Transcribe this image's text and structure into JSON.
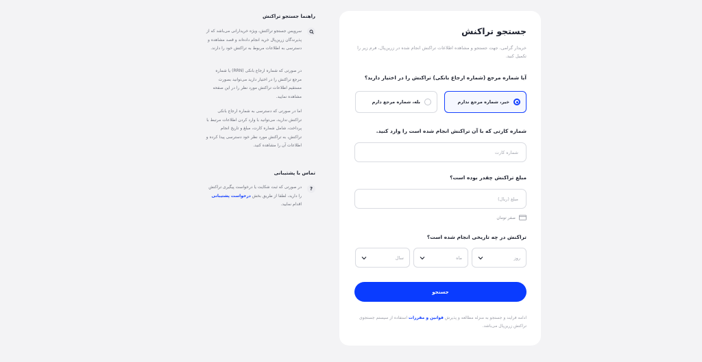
{
  "card": {
    "title": "جستجو تراکنش",
    "description": "خریدار گرامی، جهت جستجو و مشاهده اطلاعات تراکنش انجام شده در زرین‌پال، فرم زیر را تکمیل کنید.",
    "question_ref": "آیا شماره مرجع (شماره ارجاع بانکی) تراکنش را در اختیار دارید؟",
    "option_no": "خیر، شماره مرجع ندارم",
    "option_yes": "بله، شماره مرجع دارم",
    "selected_option": "no",
    "question_card": "شماره کارتی که با آن تراکنش انجام شده است را وارد کنید.",
    "card_placeholder": "شماره کارت",
    "question_amount": "مبلغ تراکنش چقدر بوده است؟",
    "amount_placeholder": "مبلغ (ریال)",
    "amount_in_words": "صفر تومان",
    "question_date": "تراکنش در چه تاریخی انجام شده است؟",
    "day_placeholder": "روز",
    "month_placeholder": "ماه",
    "year_placeholder": "سال",
    "search_label": "جستجو",
    "terms_before": "ادامه فرایند و جستجو به منزله مطالعه و پذیرش ",
    "terms_link": "قوانین و مقررات",
    "terms_after": " استفاده از سیستم جستجوی تراکنش زرین‌پال می‌باشد.",
    "accent_color": "#0a3cff"
  },
  "guide": {
    "title": "راهنما جستجو تراکنش",
    "p1": "سرویس جستجو تراکنش، ویژه خریدارانی می‌باشد که از پذیرندگان زرین‌پال خرید انجام داده‌اند و قصد مشاهده و دسترسی به اطلاعات مربوط به تراکنش خود را دارند.",
    "p2": "در صورتی که شماره ارجاع بانکی (RRN) یا شماره مرجع تراکنش را در اختیار دارید می‌توانید بصورت مستقیم اطلاعات تراکنش مورد نظر را در این صفحه مشاهده نمایید.",
    "p3": "اما در صورتی که دسترسی به شماره ارجاع بانکی تراکنش ندارید، می‌توانید با وارد کردن اطلاعات مرتبط با پرداخت، شامل شماره کارت، مبلغ و تاریخ انجام تراکنش، به تراکنش مورد نظر خود دسترسی پیدا کرده و اطلاعات آن را مشاهده کنید.",
    "support_title": "تماس با پشتیبانی",
    "support_before": "در صورتی که ثبت شکایت یا درخواست پیگیری تراکنش را دارید، لطفا از طریق بخش ",
    "support_link": "درخواست پشتیبانی",
    "support_after": " اقدام نمایید.",
    "support_icon_glyph": "?"
  }
}
